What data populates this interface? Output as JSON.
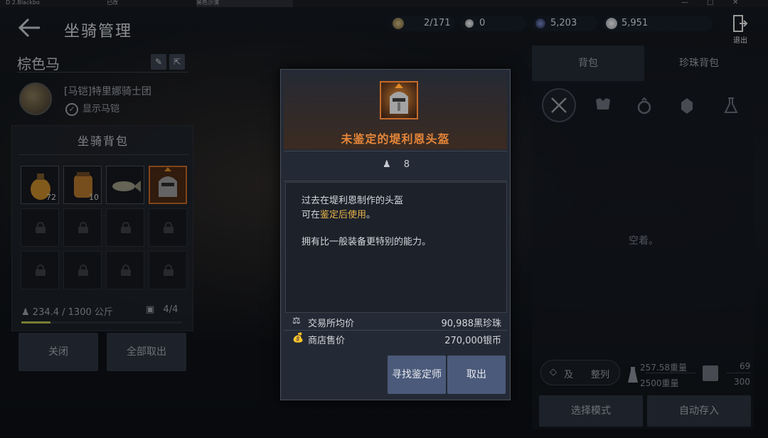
{
  "window_tabs": [
    {
      "label": "D 2.Blackbo"
    },
    {
      "label": "已改"
    },
    {
      "label": "黑色沙漠"
    }
  ],
  "header": {
    "title": "坐骑管理",
    "exit_label": "退出"
  },
  "resources": [
    {
      "icon": "medal-coin-icon",
      "value": "2/171",
      "color": "#b7a06a"
    },
    {
      "icon": "white-pearl-icon",
      "value": "0",
      "color": "#d9dde3"
    },
    {
      "icon": "dark-orb-icon",
      "value": "5,203",
      "color": "#3b4a80"
    },
    {
      "icon": "silver-coin-icon",
      "value": "5,951",
      "color": "#dfe2e6"
    }
  ],
  "left": {
    "horse_name": "棕色马",
    "armor_name": "[马铠]特里娜骑士团",
    "show_armor": "显示马铠",
    "bag_title": "坐骑背包",
    "slots": [
      {
        "icon": "potion-icon",
        "count": "72"
      },
      {
        "icon": "feed-bag-icon",
        "count": "10"
      },
      {
        "icon": "fish-icon",
        "count": ""
      },
      {
        "icon": "helmet-icon",
        "count": ""
      }
    ],
    "weight": "234.4 / 1300 公斤",
    "capacity": "4/4",
    "weight_ratio": 0.18,
    "close_label": "关闭",
    "take_all_label": "全部取出"
  },
  "right": {
    "tabs": [
      {
        "label": "背包"
      },
      {
        "label": "珍珠背包"
      }
    ],
    "filters": [
      "crossed-swords-icon",
      "armor-icon",
      "ring-icon",
      "gem-icon",
      "flask-icon"
    ],
    "empty_text": "空着。",
    "sort_left": "及",
    "sort_right": "整列",
    "weight_top": "257.58重量",
    "weight_bottom": "2500重量",
    "slots_top": "69",
    "slots_bottom": "300",
    "select_mode_label": "选择模式",
    "auto_store_label": "自动存入"
  },
  "modal": {
    "title": "未鉴定的堤利恩头盔",
    "weight": "8",
    "desc_line1": "过去在堤利恩制作的头盔",
    "desc_line2_pre": "可在",
    "desc_line2_hl": "鉴定后使用",
    "desc_line2_post": "。",
    "desc_line3": "拥有比一般装备更特别的能力。",
    "trade_label": "交易所均价",
    "trade_value": "90,988黑珍珠",
    "shop_label": "商店售价",
    "shop_value": "270,000银币",
    "find_appraiser_label": "寻找鉴定师",
    "take_out_label": "取出",
    "accent_color": "#e4863a",
    "highlight_color": "#e9b24a"
  }
}
